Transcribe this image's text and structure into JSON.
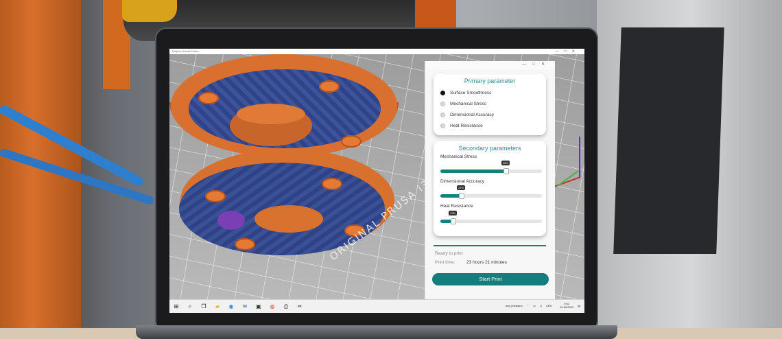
{
  "app": {
    "window_title": "Dolphin Virtual Printer",
    "window_controls": [
      "—",
      "□",
      "✕"
    ]
  },
  "viewport": {
    "bed_label": "ORIGINAL PRUSA i3 MK3",
    "model_color": "#d9702f",
    "infill_color": "#3b4f8f"
  },
  "panel": {
    "primary": {
      "title": "Primary parameter",
      "options": [
        {
          "label": "Surface Smoothness",
          "selected": true
        },
        {
          "label": "Mechanical Stress",
          "selected": false
        },
        {
          "label": "Dimensional Accuracy",
          "selected": false
        },
        {
          "label": "Heat Resistance",
          "selected": false
        }
      ]
    },
    "secondary": {
      "title": "Secondary parameters",
      "sliders": [
        {
          "label": "Mechanical Stress",
          "value": 65,
          "value_text": "65%"
        },
        {
          "label": "Dimensional Accuracy",
          "value": 21,
          "value_text": "21%"
        },
        {
          "label": "Heat Resistance",
          "value": 13,
          "value_text": "13%"
        }
      ]
    },
    "status_text": "Ready to print",
    "print_time_label": "Print time:",
    "print_time_value": "23 hours 21 minutes",
    "start_button": "Start Print",
    "accent_color": "#137e7c"
  },
  "taskbar": {
    "icons": [
      "windows-icon",
      "search-icon",
      "task-view-icon",
      "file-explorer-icon",
      "edge-icon",
      "mail-icon",
      "store-icon",
      "media-icon",
      "printer-app-icon",
      "slicer-app-icon"
    ],
    "tray_weather": "Inny pheśamo",
    "tray_lang": "CES",
    "clock_time": "9:51",
    "clock_date": "04.05.2022"
  }
}
